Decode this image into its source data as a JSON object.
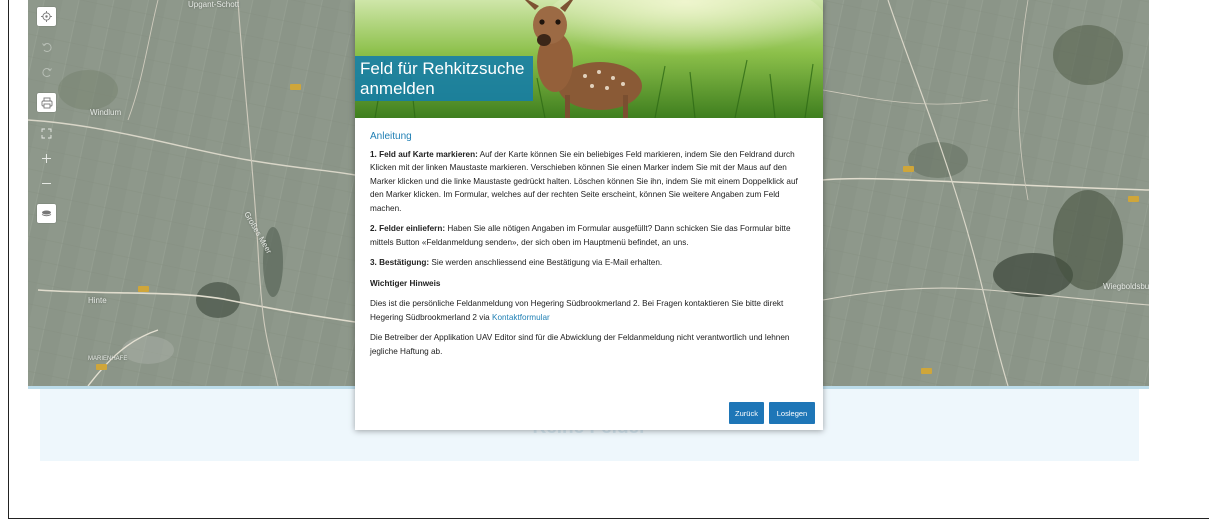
{
  "map": {
    "places": [
      {
        "name": "Upgant-Schott"
      },
      {
        "name": "Windlum"
      },
      {
        "name": "Großes Meer"
      },
      {
        "name": "Hinte"
      },
      {
        "name": "Wiegboldsbur"
      },
      {
        "name": "MARIENHAFE"
      }
    ],
    "road_badges": [
      "72",
      "210",
      "27",
      "210",
      "210",
      "436",
      "210"
    ],
    "tools": [
      {
        "name": "locate",
        "icon": "target-icon"
      },
      {
        "name": "undo",
        "icon": "undo-icon"
      },
      {
        "name": "redo",
        "icon": "redo-icon"
      },
      {
        "name": "print",
        "icon": "print-icon"
      },
      {
        "name": "fullscreen",
        "icon": "fullscreen-icon"
      },
      {
        "name": "zoom-in",
        "icon": "plus-icon"
      },
      {
        "name": "zoom-out",
        "icon": "minus-icon"
      },
      {
        "name": "layers",
        "icon": "layers-icon"
      }
    ]
  },
  "panel": {
    "empty_text": "Keine Felder"
  },
  "modal": {
    "title_line1": "Feld für Rehkitzsuche",
    "title_line2": "anmelden",
    "section_title": "Anleitung",
    "step1_label": "1. Feld auf Karte markieren:",
    "step1_text": "Auf der Karte können Sie ein beliebiges Feld markieren, indem Sie den Feldrand durch Klicken mit der linken Maustaste markieren. Verschieben können Sie einen Marker indem Sie mit der Maus auf den Marker klicken und die linke Maustaste gedrückt halten. Löschen können Sie ihn, indem Sie mit einem Doppelklick auf den Marker klicken. Im Formular, welches auf der rechten Seite erscheint, können Sie weitere Angaben zum Feld machen.",
    "step2_label": "2. Felder einliefern:",
    "step2_text": "Haben Sie alle nötigen Angaben im Formular ausgefüllt? Dann schicken Sie das Formular bitte mittels Button «Feldanmeldung senden», der sich oben im Hauptmenü befindet, an uns.",
    "step3_label": "3. Bestätigung:",
    "step3_text": "Sie werden anschliessend eine Bestätigung via E-Mail erhalten.",
    "hint_title": "Wichtiger Hinweis",
    "hint_text": "Dies ist die persönliche Feldanmeldung von Hegering Südbrookmerland 2. Bei Fragen kontaktieren Sie bitte direkt Hegering Südbrookmerland 2 via",
    "contact_link": "Kontaktformular",
    "disclaimer": "Die Betreiber der Applikation UAV Editor sind für die Abwicklung der Feldanmeldung nicht verantwortlich und lehnen jegliche Haftung ab.",
    "back_button": "Zurück",
    "start_button": "Loslegen"
  },
  "colors": {
    "accent": "#1e76b7",
    "link": "#1f7fb4",
    "title_overlay": "#147daa"
  }
}
